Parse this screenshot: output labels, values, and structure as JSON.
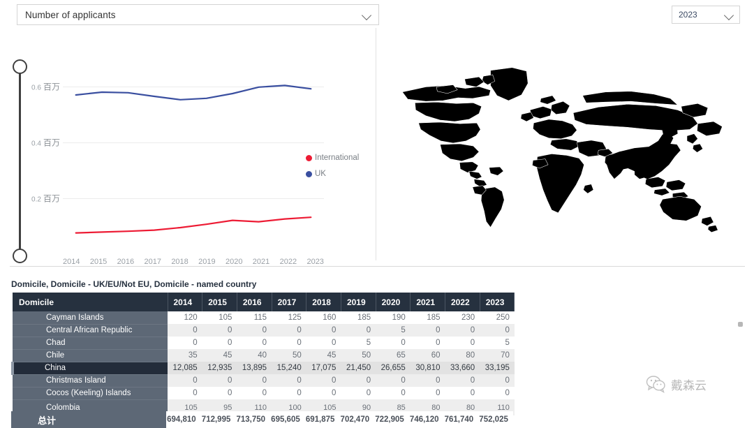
{
  "controls": {
    "metric": {
      "value": "Number of applicants",
      "icon": "chevron-down-icon"
    },
    "year": {
      "value": "2023",
      "icon": "chevron-down-icon"
    }
  },
  "chart_data": {
    "type": "line",
    "title": "",
    "xlabel": "",
    "ylabel": "",
    "categories": [
      "2014",
      "2015",
      "2016",
      "2017",
      "2018",
      "2019",
      "2020",
      "2021",
      "2022",
      "2023"
    ],
    "ytick_labels": [
      "0.6 百万",
      "0.4 百万",
      "0.2 百万"
    ],
    "ytick_values": [
      600000,
      400000,
      200000
    ],
    "ylim": [
      0,
      700000
    ],
    "grid": true,
    "legend_position": "right",
    "series": [
      {
        "name": "International",
        "color": "#ED1B34",
        "values": [
          76000,
          79000,
          82000,
          86000,
          95000,
          107000,
          121000,
          116000,
          126000,
          132000
        ]
      },
      {
        "name": "UK",
        "color": "#3A4FA0",
        "values": [
          570000,
          580000,
          578000,
          565000,
          553000,
          558000,
          575000,
          598000,
          604000,
          592000
        ]
      }
    ]
  },
  "map": {
    "highlighted_country": "China",
    "highlight_color": "#ED1B34",
    "base_color": "#DEDEDE"
  },
  "table": {
    "caption": "Domicile, Domicile - UK/EU/Not EU, Domicile - named country",
    "columns": [
      "Domicile",
      "2014",
      "2015",
      "2016",
      "2017",
      "2018",
      "2019",
      "2020",
      "2021",
      "2022",
      "2023"
    ],
    "rows": [
      {
        "name": "Cayman Islands",
        "selected": false,
        "values": [
          "120",
          "105",
          "115",
          "125",
          "160",
          "185",
          "190",
          "185",
          "230",
          "250"
        ]
      },
      {
        "name": "Central African Republic",
        "selected": false,
        "values": [
          "0",
          "0",
          "0",
          "0",
          "0",
          "0",
          "5",
          "0",
          "0",
          "0"
        ]
      },
      {
        "name": "Chad",
        "selected": false,
        "values": [
          "0",
          "0",
          "0",
          "0",
          "0",
          "5",
          "0",
          "0",
          "0",
          "5"
        ]
      },
      {
        "name": "Chile",
        "selected": false,
        "values": [
          "35",
          "45",
          "40",
          "50",
          "45",
          "50",
          "65",
          "60",
          "80",
          "70"
        ]
      },
      {
        "name": "China",
        "selected": true,
        "values": [
          "12,085",
          "12,935",
          "13,895",
          "15,240",
          "17,075",
          "21,450",
          "26,655",
          "30,810",
          "33,660",
          "33,195"
        ]
      },
      {
        "name": "Christmas Island",
        "selected": false,
        "values": [
          "0",
          "0",
          "0",
          "0",
          "0",
          "0",
          "0",
          "0",
          "0",
          "0"
        ]
      },
      {
        "name": "Cocos (Keeling) Islands",
        "selected": false,
        "values": [
          "0",
          "0",
          "0",
          "0",
          "0",
          "0",
          "0",
          "0",
          "0",
          "0"
        ]
      },
      {
        "name": "Colombia",
        "selected": false,
        "values": [
          "105",
          "95",
          "110",
          "100",
          "105",
          "90",
          "85",
          "80",
          "80",
          "110"
        ]
      }
    ],
    "total": {
      "label": "总计",
      "values": [
        "694,810",
        "712,995",
        "713,750",
        "695,605",
        "691,875",
        "702,470",
        "722,905",
        "746,120",
        "761,740",
        "752,025"
      ]
    }
  },
  "watermark": {
    "text": "戴森云",
    "icon": "wechat-icon"
  }
}
